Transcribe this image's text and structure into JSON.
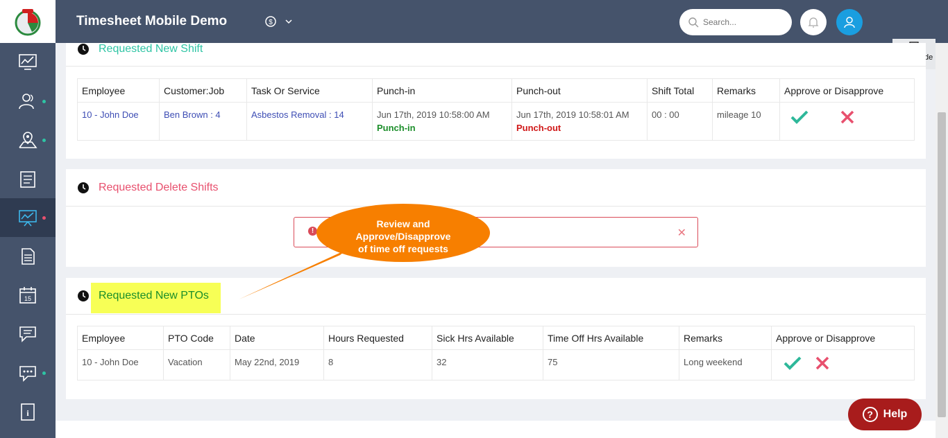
{
  "header": {
    "app_title": "Timesheet Mobile Demo",
    "search_placeholder": "Search..."
  },
  "page_guide_label": "page guide",
  "new_shift": {
    "title": "Requested New Shift",
    "title_color": "#2ec4a4",
    "columns": [
      "Employee",
      "Customer:Job",
      "Task Or Service",
      "Punch-in",
      "Punch-out",
      "Shift Total",
      "Remarks",
      "Approve or Disapprove"
    ],
    "row": {
      "employee": "10 - John Doe",
      "customer_job": "Ben Brown : 4",
      "task": "Asbestos Removal : 14",
      "punch_in_time": "Jun 17th, 2019 10:58:00 AM",
      "punch_in_label": "Punch-in",
      "punch_out_time": "Jun 17th, 2019 10:58:01 AM",
      "punch_out_label": "Punch-out",
      "shift_total": "00 : 00",
      "remarks": "mileage 10"
    }
  },
  "delete_shifts": {
    "title": "Requested Delete Shifts",
    "title_color": "#e8506e"
  },
  "callout": {
    "line1": "Review and",
    "line2": "Approve/Disapprove",
    "line3": "of time off requests",
    "color": "#f77f00"
  },
  "new_ptos": {
    "title": "Requested New PTOs",
    "title_color": "#1b8e2a",
    "columns": [
      "Employee",
      "PTO Code",
      "Date",
      "Hours Requested",
      "Sick Hrs Available",
      "Time Off Hrs Available",
      "Remarks",
      "Approve or Disapprove"
    ],
    "row": {
      "employee": "10 - John Doe",
      "pto_code": "Vacation",
      "date": "May 22nd, 2019",
      "hours": "8",
      "sick": "32",
      "timeoff": "75",
      "remarks": "Long weekend"
    }
  },
  "help_label": "Help"
}
